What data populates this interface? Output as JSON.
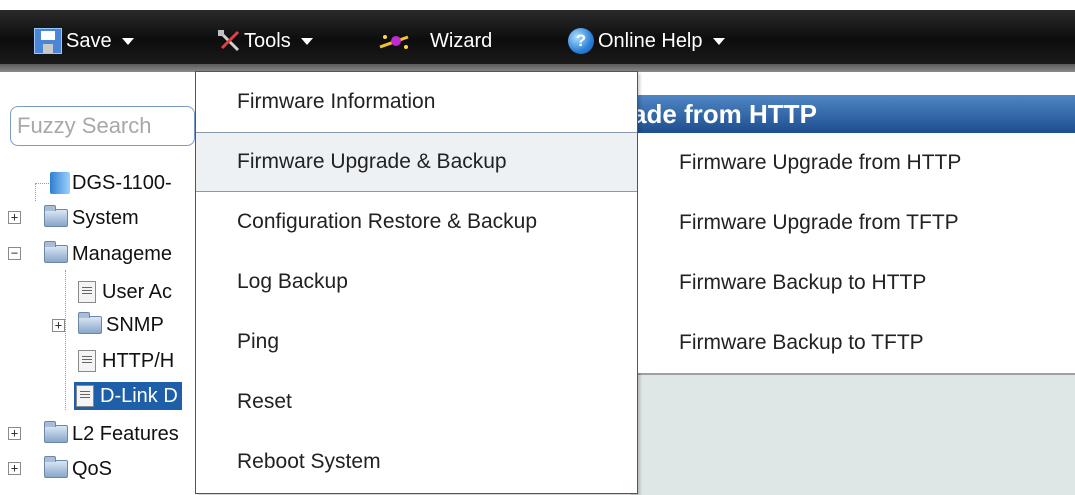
{
  "toolbar": {
    "save_label": "Save",
    "tools_label": "Tools",
    "wizard_label": "Wizard",
    "help_label": "Online Help"
  },
  "search": {
    "placeholder": "Fuzzy Search"
  },
  "tree": {
    "device": "DGS-1100-",
    "system": "System",
    "management": "Manageme",
    "user_accounts": "User Ac",
    "snmp": "SNMP",
    "http": "HTTP/H",
    "dlink": "D-Link D",
    "l2": "L2 Features",
    "qos": "QoS"
  },
  "content": {
    "title": "ade from HTTP"
  },
  "tools_menu": {
    "items": [
      "Firmware Information",
      "Firmware Upgrade & Backup",
      "Configuration Restore & Backup",
      "Log Backup",
      "Ping",
      "Reset",
      "Reboot System"
    ],
    "highlighted": "Firmware Upgrade & Backup"
  },
  "submenu": {
    "items": [
      "Firmware Upgrade from HTTP",
      "Firmware Upgrade from TFTP",
      "Firmware Backup to HTTP",
      "Firmware Backup to TFTP"
    ]
  },
  "colors": {
    "toolbar_bg": "#111111",
    "title_bar": "#2f68aa",
    "selected_node": "#1f5faa",
    "menu_highlight": "#eef1f3"
  }
}
